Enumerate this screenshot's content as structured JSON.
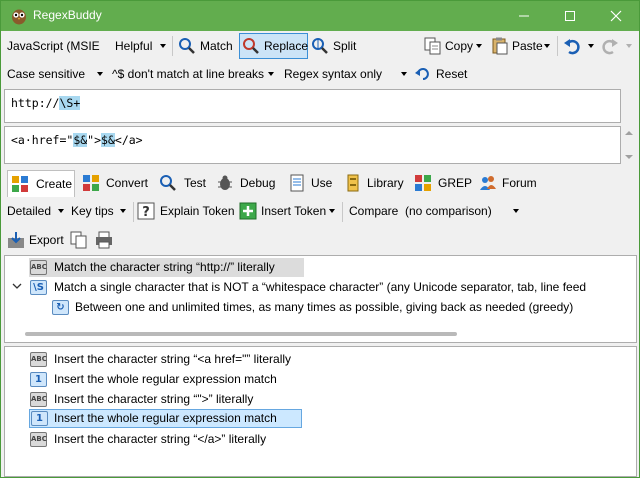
{
  "window": {
    "title": "RegexBuddy"
  },
  "toolbar1": {
    "flavor": "JavaScript (MSIE s",
    "helpful": "Helpful",
    "match": "Match",
    "replace": "Replace",
    "split": "Split",
    "copy": "Copy",
    "paste": "Paste"
  },
  "toolbar2": {
    "case": "Case sensitive",
    "linebreaks": "^$ don't match at line breaks",
    "syntax": "Regex syntax only",
    "reset": "Reset"
  },
  "regex": {
    "prefix": "http://",
    "highlight": "\\S+"
  },
  "replacement": {
    "p1": "<a·href=\"",
    "m1": "$&",
    "p2": "\">",
    "m2": "$&",
    "p3": "</a>"
  },
  "tabs": [
    {
      "label": "Create"
    },
    {
      "label": "Convert"
    },
    {
      "label": "Test"
    },
    {
      "label": "Debug"
    },
    {
      "label": "Use"
    },
    {
      "label": "Library"
    },
    {
      "label": "GREP"
    },
    {
      "label": "Forum"
    }
  ],
  "create_toolbar": {
    "detail": "Detailed",
    "keytips": "Key tips",
    "explain": "Explain Token",
    "insert": "Insert Token",
    "compare": "Compare",
    "comparison": "(no comparison)",
    "export": "Export"
  },
  "regex_tree": [
    {
      "text": "Match the character string “http://” literally",
      "badge": "ABC"
    },
    {
      "text": "Match a single character that is NOT a “whitespace character” (any Unicode separator, tab, line feed",
      "badge": "\\S"
    },
    {
      "text": "Between one and unlimited times, as many times as possible, giving back as needed (greedy)",
      "badge": "+"
    }
  ],
  "replace_tree": [
    {
      "text": "Insert the character string “<a href=\"” literally",
      "badge": "ABC"
    },
    {
      "text": "Insert the whole regular expression match",
      "badge": "1"
    },
    {
      "text": "Insert the character string “\">” literally",
      "badge": "ABC"
    },
    {
      "text": "Insert the whole regular expression match",
      "badge": "1"
    },
    {
      "text": "Insert the character string “</a>” literally",
      "badge": "ABC"
    }
  ]
}
